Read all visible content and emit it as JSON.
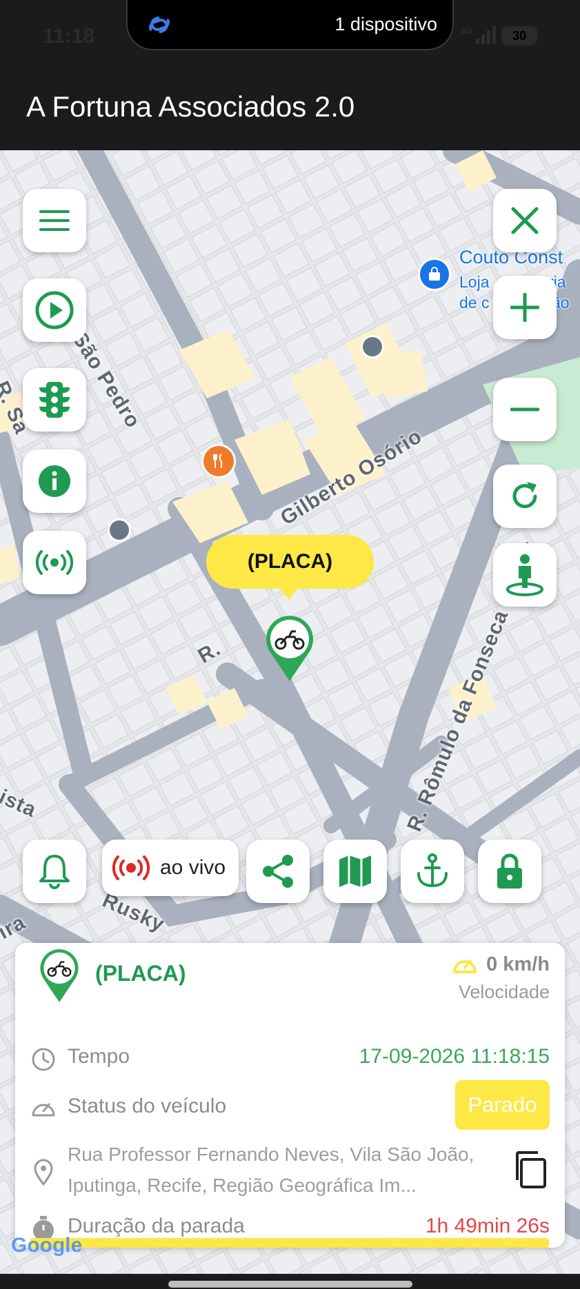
{
  "status_bar": {
    "time": "11:18",
    "island_text": "1 dispositivo",
    "network": "4G",
    "battery": "30"
  },
  "app_bar": {
    "title": "A Fortuna Associados 2.0"
  },
  "map": {
    "streets": [
      "São Pedro",
      "Gilberto Osório",
      "R. Rômulo da Fonseca Lemes",
      "R. Sá",
      "R.",
      "Rusky",
      "ista",
      "ira"
    ],
    "poi": {
      "name": "Couto Const",
      "line2": "Loja",
      "line2b": "ria",
      "line3": "de c",
      "line3b": "ão"
    },
    "attribution": "Google"
  },
  "marker": {
    "plate": "(PLACA)"
  },
  "controls": {
    "left": [
      "menu-icon",
      "play-icon",
      "traffic-light-icon",
      "info-icon",
      "broadcast-icon"
    ],
    "right": [
      "close-icon",
      "zoom-in-icon",
      "zoom-out-icon",
      "refresh-icon",
      "street-view-icon"
    ],
    "bottom_live_label": "ao vivo",
    "accent": "#1e9a52"
  },
  "card": {
    "plate": "(PLACA)",
    "speed": "0 km/h",
    "speed_label": "Velocidade",
    "time_label": "Tempo",
    "time_value": "17-09-2026 11:18:15",
    "status_label": "Status do veículo",
    "status_value": "Parado",
    "address": "Rua Professor Fernando Neves, Vila São João, Iputinga, Recife, Região Geográfica Im...",
    "duration_label": "Duração da parada",
    "duration_value": "1h 49min 26s"
  }
}
